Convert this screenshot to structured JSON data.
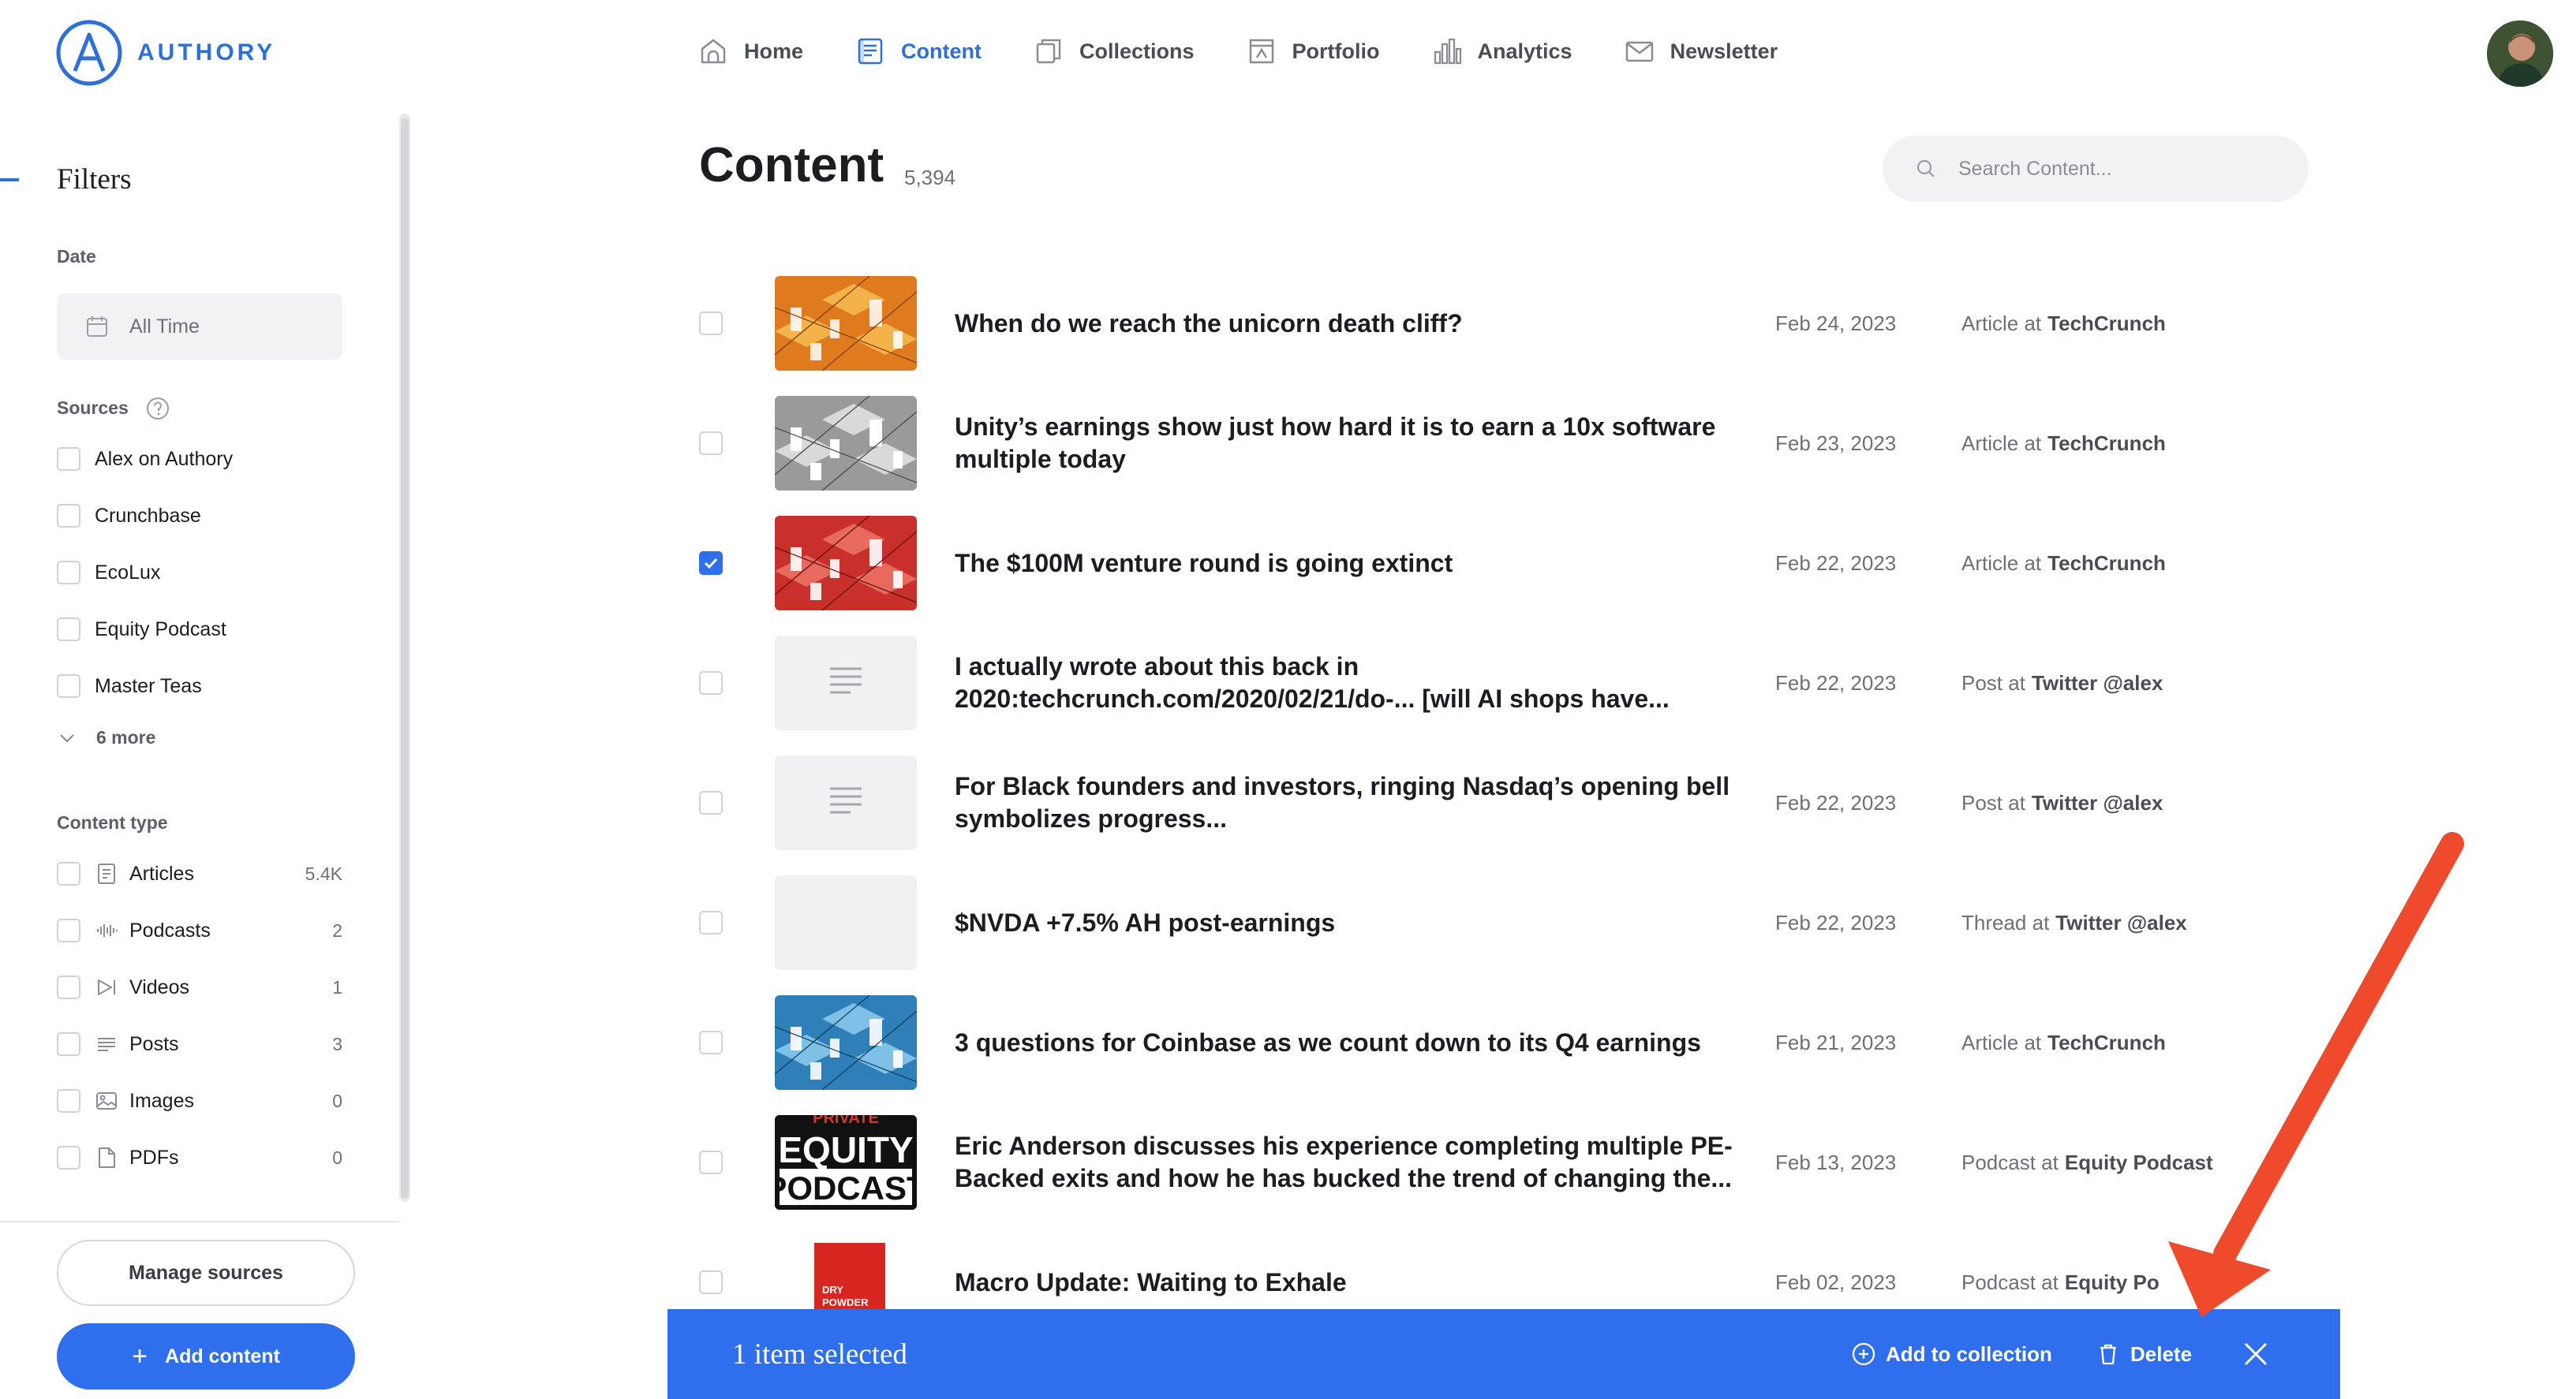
{
  "brand": {
    "name": "AUTHORY",
    "accent": "#2f6fd8",
    "primary_button": "#2f6fed"
  },
  "nav": {
    "items": [
      {
        "label": "Home",
        "icon": "home-icon"
      },
      {
        "label": "Content",
        "icon": "content-icon",
        "active": true
      },
      {
        "label": "Collections",
        "icon": "collections-icon"
      },
      {
        "label": "Portfolio",
        "icon": "portfolio-icon"
      },
      {
        "label": "Analytics",
        "icon": "analytics-icon"
      },
      {
        "label": "Newsletter",
        "icon": "newsletter-icon"
      }
    ]
  },
  "sidebar": {
    "title": "Filters",
    "date": {
      "label": "Date",
      "value": "All Time",
      "icon": "calendar-icon"
    },
    "sources": {
      "label": "Sources",
      "items": [
        "Alex on Authory",
        "Crunchbase",
        "EcoLux",
        "Equity Podcast",
        "Master Teas"
      ],
      "more_label": "6 more"
    },
    "content_type": {
      "label": "Content type",
      "items": [
        {
          "label": "Articles",
          "count": "5.4K",
          "icon": "article-icon"
        },
        {
          "label": "Podcasts",
          "count": "2",
          "icon": "podcast-icon"
        },
        {
          "label": "Videos",
          "count": "1",
          "icon": "video-icon"
        },
        {
          "label": "Posts",
          "count": "3",
          "icon": "post-icon"
        },
        {
          "label": "Images",
          "count": "0",
          "icon": "image-icon"
        },
        {
          "label": "PDFs",
          "count": "0",
          "icon": "pdf-icon"
        }
      ]
    },
    "manage_sources": "Manage sources",
    "add_content": "Add content"
  },
  "main": {
    "title": "Content",
    "count": "5,394",
    "search_placeholder": "Search Content...",
    "rows": [
      {
        "title": "When do we reach the unicorn death cliff?",
        "date": "Feb 24, 2023",
        "type": "Article at",
        "source": "TechCrunch",
        "checked": false,
        "thumb": "tc-orange"
      },
      {
        "title": "Unity’s earnings show just how hard it is to earn a 10x software multiple today",
        "date": "Feb 23, 2023",
        "type": "Article at",
        "source": "TechCrunch",
        "checked": false,
        "thumb": "tc-gray"
      },
      {
        "title": "The $100M venture round is going extinct",
        "date": "Feb 22, 2023",
        "type": "Article at",
        "source": "TechCrunch",
        "checked": true,
        "thumb": "tc-red"
      },
      {
        "title": "I actually wrote about this back in 2020:techcrunch.com/2020/02/21/do-... [will AI shops have...",
        "date": "Feb 22, 2023",
        "type": "Post at",
        "source": "Twitter @alex",
        "checked": false,
        "thumb": "text-post"
      },
      {
        "title": "For Black founders and investors, ringing Nasdaq’s opening bell symbolizes progress...",
        "date": "Feb 22, 2023",
        "type": "Post at",
        "source": "Twitter @alex",
        "checked": false,
        "thumb": "text-post"
      },
      {
        "title": "$NVDA +7.5% AH post-earnings",
        "date": "Feb 22, 2023",
        "type": "Thread at",
        "source": "Twitter @alex",
        "checked": false,
        "thumb": "blank"
      },
      {
        "title": "3 questions for Coinbase as we count down to its Q4 earnings",
        "date": "Feb 21, 2023",
        "type": "Article at",
        "source": "TechCrunch",
        "checked": false,
        "thumb": "tc-blue"
      },
      {
        "title": "Eric Anderson discusses his experience completing multiple PE-Backed exits and how he has bucked the trend of changing the...",
        "date": "Feb 13, 2023",
        "type": "Podcast at",
        "source": "Equity Podcast",
        "checked": false,
        "thumb": "equity"
      },
      {
        "title": "Macro Update: Waiting to Exhale",
        "date": "Feb 02, 2023",
        "type": "Podcast at",
        "source": "Equity Po",
        "checked": false,
        "thumb": "dry-powder"
      }
    ]
  },
  "selection_bar": {
    "text": "1 item selected",
    "add_to_collection": "Add to collection",
    "delete": "Delete"
  },
  "thumb_text": {
    "equity_top": "PRIVATE",
    "equity_line1": "EQUITY",
    "equity_line2": "PODCAST",
    "dry_powder_1": "DRY",
    "dry_powder_2": "POWDER"
  },
  "annotation": {
    "arrow_color": "#ee4a2b"
  }
}
